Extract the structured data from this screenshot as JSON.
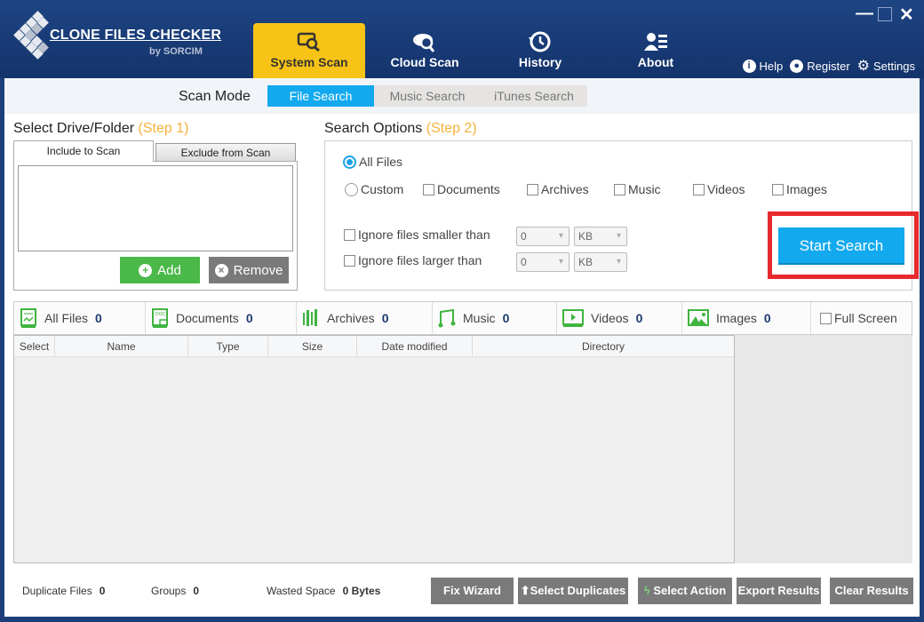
{
  "app": {
    "title": "CLONE FILES CHECKER",
    "subtitle": "by SORCIM"
  },
  "nav": {
    "tabs": [
      {
        "label": "System Scan",
        "icon": "system-scan-icon",
        "active": true
      },
      {
        "label": "Cloud Scan",
        "icon": "cloud-scan-icon"
      },
      {
        "label": "History",
        "icon": "history-icon"
      },
      {
        "label": "About",
        "icon": "about-icon"
      }
    ],
    "links": [
      {
        "label": "Help",
        "icon": "info-icon"
      },
      {
        "label": "Register",
        "icon": "user-icon"
      },
      {
        "label": "Settings",
        "icon": "gear-icon"
      }
    ]
  },
  "window": {
    "minimize": "—",
    "close": "✕"
  },
  "scan_mode": {
    "label": "Scan Mode",
    "tabs": [
      {
        "label": "File Search",
        "active": true
      },
      {
        "label": "Music Search"
      },
      {
        "label": "iTunes Search"
      }
    ]
  },
  "step1": {
    "title": "Select Drive/Folder",
    "step": "(Step 1)",
    "include_tab": "Include to Scan",
    "exclude_tab": "Exclude from Scan",
    "add_label": "Add",
    "remove_label": "Remove"
  },
  "step2": {
    "title": "Search Options",
    "step": "(Step 2)",
    "all_files": "All Files",
    "custom": "Custom",
    "types": [
      "Documents",
      "Archives",
      "Music",
      "Videos",
      "Images"
    ],
    "ignore_smaller": "Ignore files smaller than",
    "ignore_larger": "Ignore files larger than",
    "smaller_value": "0",
    "smaller_unit": "KB",
    "larger_value": "0",
    "larger_unit": "KB",
    "start_label": "Start Search"
  },
  "categories": [
    {
      "label": "All Files",
      "count": "0"
    },
    {
      "label": "Documents",
      "count": "0"
    },
    {
      "label": "Archives",
      "count": "0"
    },
    {
      "label": "Music",
      "count": "0"
    },
    {
      "label": "Videos",
      "count": "0"
    },
    {
      "label": "Images",
      "count": "0"
    }
  ],
  "full_screen": "Full Screen",
  "table": {
    "columns": [
      "Select",
      "Name",
      "Type",
      "Size",
      "Date modified",
      "Directory"
    ]
  },
  "status": {
    "duplicate_label": "Duplicate Files",
    "duplicate_value": "0",
    "groups_label": "Groups",
    "groups_value": "0",
    "wasted_label": "Wasted Space",
    "wasted_value": "0 Bytes"
  },
  "actions": {
    "fix_wizard": "Fix Wizard",
    "select_duplicates": "Select Duplicates",
    "select_action": "Select Action",
    "export_results": "Export Results",
    "clear_results": "Clear Results"
  },
  "colors": {
    "header": "#1c3f7a",
    "active_tab": "#f7c316",
    "accent_blue": "#12a9ef",
    "green": "#4bb84a",
    "step_orange": "#f5b23a",
    "highlight_red": "#e8292e"
  }
}
